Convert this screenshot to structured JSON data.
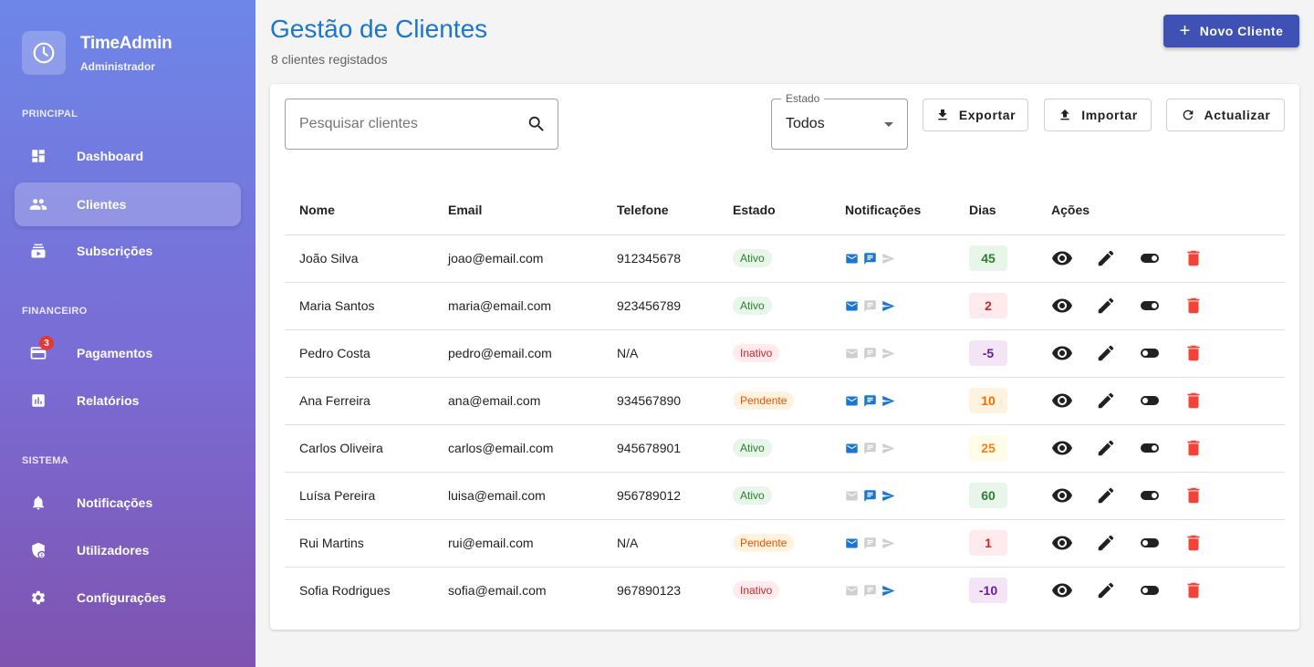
{
  "app": {
    "title": "TimeAdmin",
    "role": "Administrador"
  },
  "sidebar": {
    "sections": [
      {
        "label": "PRINCIPAL"
      },
      {
        "label": "FINANCEIRO"
      },
      {
        "label": "SISTEMA"
      }
    ],
    "items": [
      {
        "label": "Dashboard",
        "icon": "dashboard-icon"
      },
      {
        "label": "Clientes",
        "icon": "people-icon",
        "active": true
      },
      {
        "label": "Subscrições",
        "icon": "subscriptions-icon"
      },
      {
        "label": "Pagamentos",
        "icon": "credit-card-icon",
        "badge": "3"
      },
      {
        "label": "Relatórios",
        "icon": "assessment-icon"
      },
      {
        "label": "Notificações",
        "icon": "bell-icon"
      },
      {
        "label": "Utilizadores",
        "icon": "admin-user-icon"
      },
      {
        "label": "Configurações",
        "icon": "gear-icon"
      }
    ]
  },
  "header": {
    "title": "Gestão de Clientes",
    "subtitle": "8 clientes registados",
    "new_button": "Novo Cliente"
  },
  "toolbar": {
    "search_placeholder": "Pesquisar clientes",
    "filter_label": "Estado",
    "filter_value": "Todos",
    "export_label": "Exportar",
    "import_label": "Importar",
    "refresh_label": "Actualizar"
  },
  "table": {
    "columns": [
      "Nome",
      "Email",
      "Telefone",
      "Estado",
      "Notificações",
      "Dias",
      "Ações"
    ],
    "rows": [
      {
        "name": "João Silva",
        "email": "joao@email.com",
        "phone": "912345678",
        "status": "Ativo",
        "notif": [
          true,
          true,
          false
        ],
        "days": "45",
        "toggle_on": true
      },
      {
        "name": "Maria Santos",
        "email": "maria@email.com",
        "phone": "923456789",
        "status": "Ativo",
        "notif": [
          true,
          false,
          true
        ],
        "days": "2",
        "toggle_on": true
      },
      {
        "name": "Pedro Costa",
        "email": "pedro@email.com",
        "phone": "N/A",
        "status": "Inativo",
        "notif": [
          false,
          false,
          false
        ],
        "days": "-5",
        "toggle_on": false
      },
      {
        "name": "Ana Ferreira",
        "email": "ana@email.com",
        "phone": "934567890",
        "status": "Pendente",
        "notif": [
          true,
          true,
          true
        ],
        "days": "10",
        "toggle_on": false
      },
      {
        "name": "Carlos Oliveira",
        "email": "carlos@email.com",
        "phone": "945678901",
        "status": "Ativo",
        "notif": [
          true,
          false,
          false
        ],
        "days": "25",
        "toggle_on": true
      },
      {
        "name": "Luísa Pereira",
        "email": "luisa@email.com",
        "phone": "956789012",
        "status": "Ativo",
        "notif": [
          false,
          true,
          true
        ],
        "days": "60",
        "toggle_on": true
      },
      {
        "name": "Rui Martins",
        "email": "rui@email.com",
        "phone": "N/A",
        "status": "Pendente",
        "notif": [
          true,
          false,
          false
        ],
        "days": "1",
        "toggle_on": false
      },
      {
        "name": "Sofia Rodrigues",
        "email": "sofia@email.com",
        "phone": "967890123",
        "status": "Inativo",
        "notif": [
          false,
          false,
          true
        ],
        "days": "-10",
        "toggle_on": false
      }
    ]
  },
  "colors": {
    "accent": "#3f51b5",
    "title": "#1976d2",
    "notif_active": "#1976d2",
    "notif_inactive": "#cfcfcf",
    "delete": "#f44336",
    "days_green": {
      "bg": "#e8f5e9",
      "fg": "#2e7d32"
    },
    "days_red": {
      "bg": "#ffebee",
      "fg": "#c62828"
    },
    "days_purple": {
      "bg": "#f3e5f5",
      "fg": "#6a1b9a"
    },
    "days_orange": {
      "bg": "#fff3e0",
      "fg": "#ef6c00"
    },
    "days_yellow": {
      "bg": "#fffde7",
      "fg": "#f57f17"
    }
  }
}
